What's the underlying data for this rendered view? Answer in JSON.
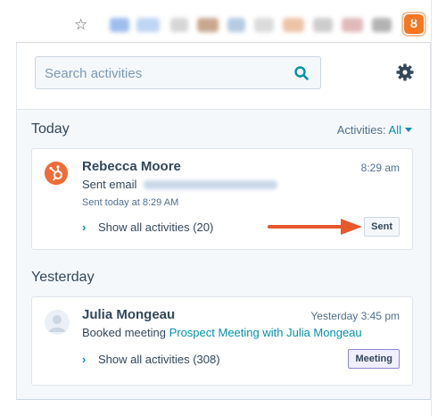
{
  "search": {
    "placeholder": "Search activities"
  },
  "filter": {
    "label": "Activities:",
    "value": "All"
  },
  "sections": [
    {
      "title": "Today"
    },
    {
      "title": "Yesterday"
    }
  ],
  "activities": [
    {
      "name": "Rebecca Moore",
      "time": "8:29 am",
      "action": "Sent email",
      "detail": "Sent today at 8:29 AM",
      "show_all": "Show all activities (20)",
      "tag": "Sent"
    },
    {
      "name": "Julia Mongeau",
      "time": "Yesterday 3:45 pm",
      "action": "Booked meeting",
      "link": "Prospect Meeting with Julia Mongeau",
      "show_all": "Show all activities (308)",
      "tag": "Meeting"
    }
  ],
  "colors": {
    "accent": "#0091ae",
    "hubspot_orange": "#f16b36",
    "annotation_arrow": "#e8582b",
    "meeting_tag_border": "#8f86d6"
  },
  "icons": [
    "star-icon",
    "hubspot-extension-icon",
    "search-icon",
    "gear-icon",
    "hubspot-sprocket-icon",
    "user-avatar-icon",
    "chevron-right-icon",
    "caret-down-icon"
  ]
}
